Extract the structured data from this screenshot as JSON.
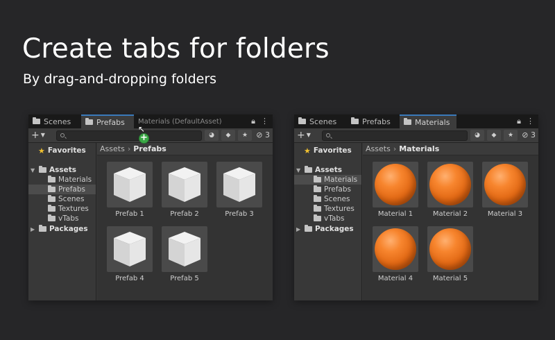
{
  "headline": "Create tabs for folders",
  "subline": "By drag-and-dropping folders",
  "left_panel": {
    "tabs": [
      {
        "label": "Scenes",
        "icon": "folder-icon",
        "selected": false
      },
      {
        "label": "Prefabs",
        "icon": "folder-icon",
        "selected": true
      }
    ],
    "dragged_tab": "Materials (DefaultAsset)",
    "hidden_count": "3",
    "sidebar": {
      "favorites": "Favorites",
      "assets": "Assets",
      "children": [
        "Materials",
        "Prefabs",
        "Scenes",
        "Textures",
        "vTabs"
      ],
      "selected_child": "Prefabs",
      "packages": "Packages"
    },
    "breadcrumb": {
      "root": "Assets",
      "current": "Prefabs"
    },
    "items": [
      "Prefab 1",
      "Prefab 2",
      "Prefab 3",
      "Prefab 4",
      "Prefab 5"
    ]
  },
  "right_panel": {
    "tabs": [
      {
        "label": "Scenes",
        "icon": "folder-icon",
        "selected": false
      },
      {
        "label": "Prefabs",
        "icon": "folder-icon",
        "selected": false
      },
      {
        "label": "Materials",
        "icon": "folder-icon",
        "selected": true
      }
    ],
    "hidden_count": "3",
    "sidebar": {
      "favorites": "Favorites",
      "assets": "Assets",
      "children": [
        "Materials",
        "Prefabs",
        "Scenes",
        "Textures",
        "vTabs"
      ],
      "selected_child": "Materials",
      "packages": "Packages"
    },
    "breadcrumb": {
      "root": "Assets",
      "current": "Materials"
    },
    "items": [
      "Material 1",
      "Material 2",
      "Material 3",
      "Material 4",
      "Material 5"
    ]
  },
  "colors": {
    "background": "#262628",
    "panel": "#383838",
    "tab_accent": "#3a79bb",
    "material_orange": "#f7852e",
    "plus_badge": "#3aa845"
  }
}
